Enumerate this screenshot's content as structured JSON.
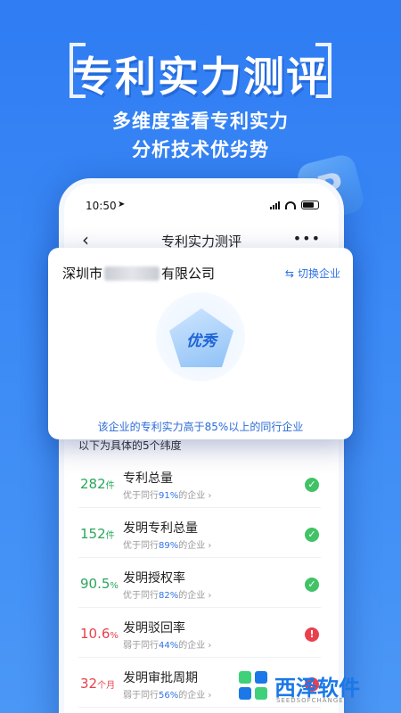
{
  "hero": {
    "title": "专利实力测评",
    "subtitle_line1": "多维度查看专利实力",
    "subtitle_line2": "分析技术优劣势"
  },
  "status_bar": {
    "time": "10:50"
  },
  "nav": {
    "back_icon": "chevron-left-icon",
    "title": "专利实力测评",
    "more_icon": "more-icon"
  },
  "card": {
    "company_prefix": "深圳市",
    "company_suffix": "有限公司",
    "switch_label": "切换企业",
    "switch_icon": "swap-icon",
    "badge_label": "优秀",
    "summary": "该企业的专利实力高于85%以上的同行企业"
  },
  "list": {
    "heading": "以下为具体的5个纬度",
    "rows": [
      {
        "value": "282",
        "unit": "件",
        "name": "专利总量",
        "desc_prefix": "优于同行",
        "percent": "91%",
        "desc_suffix": "的企业 ›",
        "status": "ok"
      },
      {
        "value": "152",
        "unit": "件",
        "name": "发明专利总量",
        "desc_prefix": "优于同行",
        "percent": "89%",
        "desc_suffix": "的企业 ›",
        "status": "ok"
      },
      {
        "value": "90.5",
        "unit": "%",
        "name": "发明授权率",
        "desc_prefix": "优于同行",
        "percent": "82%",
        "desc_suffix": "的企业 ›",
        "status": "ok"
      },
      {
        "value": "10.6",
        "unit": "%",
        "name": "发明驳回率",
        "desc_prefix": "弱于同行",
        "percent": "44%",
        "desc_suffix": "的企业 ›",
        "status": "bad"
      },
      {
        "value": "32",
        "unit": "个月",
        "name": "发明审批周期",
        "desc_prefix": "弱于同行",
        "percent": "56%",
        "desc_suffix": "的企业 ›",
        "status": "bad"
      }
    ]
  },
  "watermark": {
    "text": "西泽软件",
    "sub": "SEEDSOFCHANGE"
  },
  "colors": {
    "accent": "#2f72e6",
    "good": "#42c267",
    "bad": "#e8414d"
  }
}
